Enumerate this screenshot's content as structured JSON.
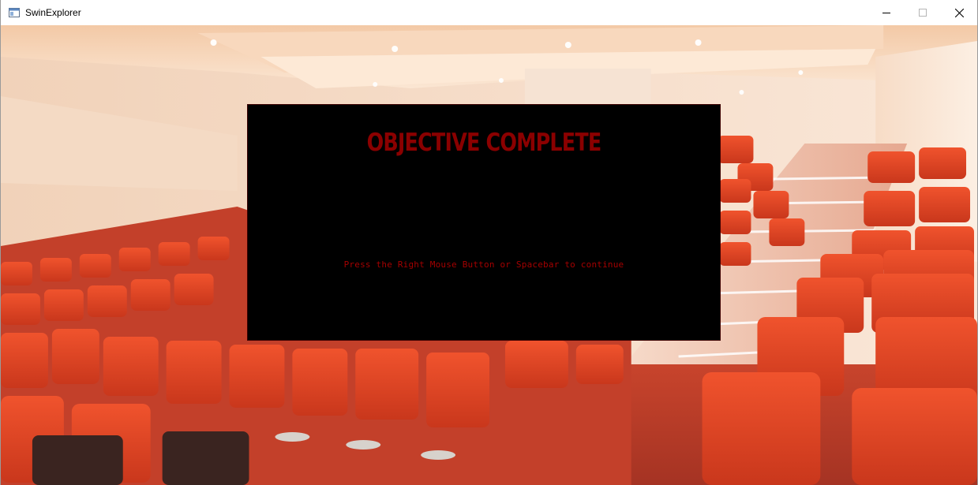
{
  "window": {
    "title": "SwinExplorer",
    "icon": "app-window-icon",
    "controls": {
      "minimize_icon": "minimize-icon",
      "maximize_icon": "maximize-icon",
      "close_icon": "close-icon"
    }
  },
  "scene": {
    "background": "lecture-theatre-red-seats"
  },
  "dialog": {
    "title": "OBJECTIVE COMPLETE",
    "message": "Press the Right Mouse Button or Spacebar to continue"
  },
  "colors": {
    "dialog_bg": "#000000",
    "title_color": "#8b0000",
    "message_color": "#a40000",
    "seat_red": "#e0401f"
  }
}
